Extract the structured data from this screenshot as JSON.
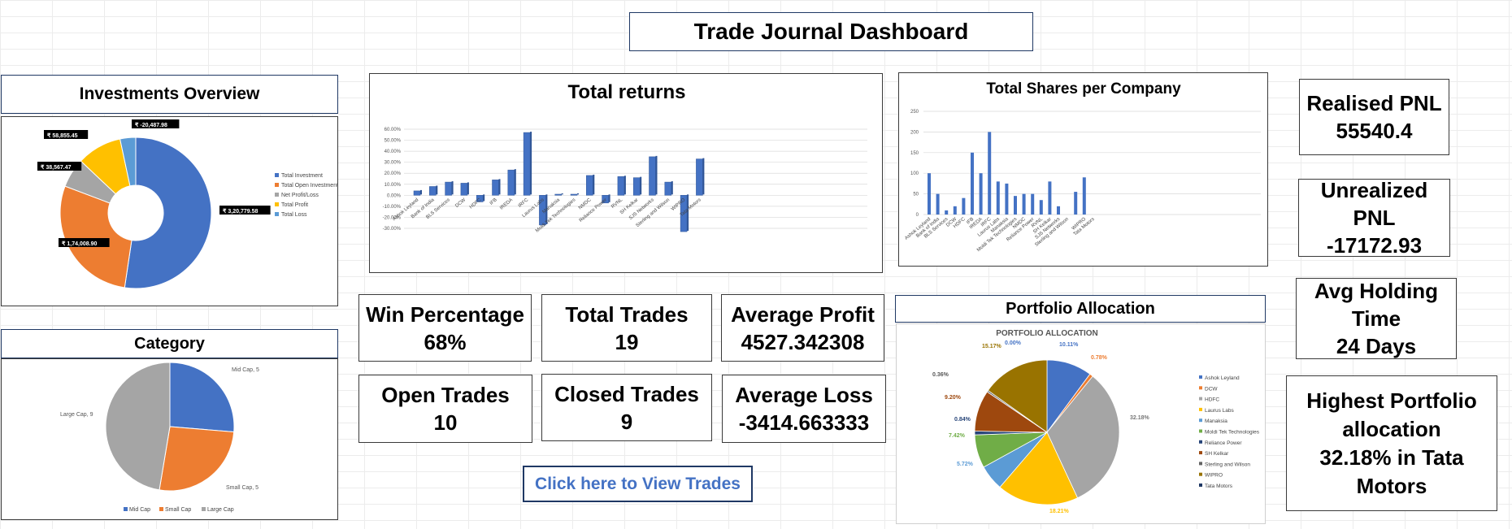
{
  "dashboard": {
    "title": "Trade Journal Dashboard"
  },
  "sections": {
    "investments_title": "Investments Overview",
    "category_title": "Category",
    "portfolio_title": "Portfolio Allocation"
  },
  "kpis": {
    "realised_label": "Realised PNL",
    "realised_value": "55540.4",
    "unrealized_label": "Unrealized PNL",
    "unrealized_value": "-17172.93",
    "holding_label": "Avg Holding Time",
    "holding_value": "24 Days",
    "highest_line1": "Highest Portfolio",
    "highest_line2": "allocation",
    "highest_line3": "32.18% in Tata",
    "highest_line4": "Motors",
    "win_label": "Win Percentage",
    "win_value": "68%",
    "total_trades_label": "Total Trades",
    "total_trades_value": "19",
    "avg_profit_label": "Average Profit",
    "avg_profit_value": "4527.342308",
    "open_trades_label": "Open Trades",
    "open_trades_value": "10",
    "closed_trades_label": "Closed Trades",
    "closed_trades_value": "9",
    "avg_loss_label": "Average Loss",
    "avg_loss_value": "-3414.663333"
  },
  "link": {
    "label": "Click here to View Trades"
  },
  "colors": {
    "blue": "#4472c4",
    "orange": "#ed7d31",
    "gray": "#a5a5a5",
    "yellow": "#ffc000",
    "lightblue": "#5b9bd5",
    "green": "#70ad47",
    "darkblue": "#264478",
    "brown": "#9e480e",
    "darkgray": "#636363",
    "olive": "#997300",
    "navy": "#1f3864"
  },
  "chart_data": [
    {
      "id": "investments",
      "type": "pie",
      "donut": true,
      "categories": [
        "Total Investment",
        "Total Open Investment",
        "Net Profit/Loss",
        "Total Profit",
        "Total Loss"
      ],
      "values": [
        320779.58,
        174008.9,
        38567.47,
        58855.45,
        20487.98
      ],
      "data_labels": [
        "₹ 3,20,779.58",
        "₹ 1,74,008.90",
        "₹ 38,567.47",
        "₹ 58,855.45",
        "₹ -20,487.98"
      ],
      "legend": "right"
    },
    {
      "id": "total_returns",
      "type": "bar",
      "title": "Total returns",
      "categories": [
        "Ashok Leyland",
        "Bank of India",
        "BLS Services",
        "DCW",
        "HDFC",
        "IFB",
        "IREDA",
        "IRFC",
        "Laurus Labs",
        "Manaksia",
        "Moldi Tek Technologies",
        "NMDC",
        "Reliance Power",
        "RVNL",
        "SH Kelkar",
        "SJS Networks",
        "Sterling and Wilson",
        "WIPRO",
        "Tata Motors"
      ],
      "values": [
        4,
        8,
        12,
        11,
        -6,
        14,
        23,
        57,
        -27,
        1,
        1,
        18,
        -7,
        17,
        16,
        35,
        12,
        -33,
        33
      ],
      "ylim": [
        -30,
        60
      ],
      "yticks": [
        "60.00%",
        "50.00%",
        "40.00%",
        "30.00%",
        "20.00%",
        "10.00%",
        "0.00%",
        "-10.00%",
        "-20.00%",
        "-30.00%"
      ],
      "grid": true
    },
    {
      "id": "total_shares",
      "type": "bar",
      "title": "Total Shares per Company",
      "categories": [
        "Ashok Leyland",
        "Bank of India",
        "BLS Services",
        "DCW",
        "HDFC",
        "IFB",
        "IREDA",
        "IRFC",
        "Laurus Labs",
        "Manaksia",
        "Moldi Tek Technologies",
        "NMDC",
        "Reliance Power",
        "RVNL",
        "SH Kelkar",
        "SJS Networks",
        "Sterling and Wilson",
        "WIPRO",
        "Tata Motors"
      ],
      "x_labels": [
        "Ashok Leyland",
        "Bank of India",
        "BLS Services",
        "DCW",
        "HDFC",
        "IFB",
        "IREDA",
        "IRFC",
        "Laurus Labs",
        "Manaksia",
        "Moldi Tek Technologies",
        "NMDC",
        "Reliance Power",
        "RVNL",
        "SH Kelkar",
        "SJS Networks",
        "Sterling and Wilson",
        "",
        "WIPRO",
        "Tata Motors"
      ],
      "values": [
        100,
        50,
        10,
        20,
        40,
        150,
        100,
        200,
        80,
        75,
        45,
        50,
        50,
        35,
        80,
        20,
        0,
        55,
        90
      ],
      "ylim": [
        0,
        250
      ],
      "yticks": [
        "250",
        "200",
        "150",
        "100",
        "50",
        "0"
      ],
      "grid": true
    },
    {
      "id": "category",
      "type": "pie",
      "categories": [
        "Mid Cap",
        "Small Cap",
        "Large Cap"
      ],
      "values": [
        5,
        5,
        9
      ],
      "data_labels": [
        "Mid Cap, 5",
        "Small Cap, 5",
        "Large Cap, 9"
      ],
      "legend": "bottom"
    },
    {
      "id": "portfolio",
      "type": "pie",
      "title": "PORTFOLIO ALLOCATION",
      "categories": [
        "Ashok Leyland",
        "DCW",
        "HDFC",
        "Laurus Labs",
        "Manaksia",
        "Moldi Tek Technologies",
        "Reliance Power",
        "SH Kelkar",
        "Sterling and Wilson",
        "WIPRO",
        "Tata Motors"
      ],
      "values": [
        10.11,
        0.78,
        32.18,
        18.21,
        5.72,
        7.42,
        0.84,
        9.2,
        0.36,
        15.17,
        0.0
      ],
      "data_labels": [
        "10.11%",
        "0.78%",
        "32.18%",
        "18.21%",
        "5.72%",
        "7.42%",
        "0.84%",
        "9.20%",
        "0.36%",
        "15.17%",
        "0.00%"
      ],
      "legend": "right"
    }
  ]
}
